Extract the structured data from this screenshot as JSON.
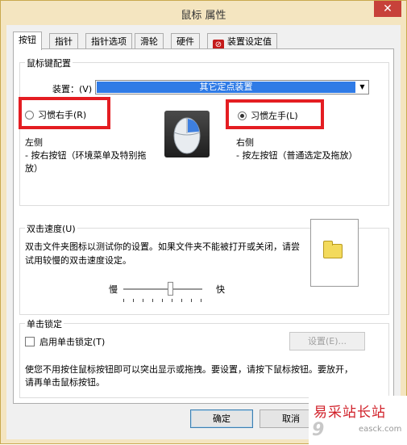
{
  "window": {
    "title": "鼠标 属性",
    "close_glyph": "✕"
  },
  "tabs": [
    {
      "label": "按钮",
      "active": true
    },
    {
      "label": "指针"
    },
    {
      "label": "指针选项"
    },
    {
      "label": "滑轮"
    },
    {
      "label": "硬件"
    },
    {
      "label": "装置设定值",
      "icon": "synaptics-icon"
    }
  ],
  "buttons_config": {
    "group_title": "鼠标键配置",
    "device_label": "装置：(V)",
    "device_value": "其它定点装置",
    "right_hand": {
      "label": "习惯右手(R)",
      "checked": false
    },
    "left_hand": {
      "label": "习惯左手(L)",
      "checked": true
    },
    "left_title": "左侧",
    "left_desc": [
      "- 按右按钮（环境菜单及特别拖",
      "放）"
    ],
    "right_title": "右侧",
    "right_desc": [
      "- 按左按钮（普通选定及拖放）"
    ],
    "highlight_color": "#e41d22"
  },
  "double_click": {
    "group_title": "双击速度(U)",
    "desc": [
      "双击文件夹图标以测试你的设置。如果文件夹不能被打开或关闭，请尝",
      "试用较慢的双击速度设定。"
    ],
    "slow_label": "慢",
    "fast_label": "快",
    "speed_fraction": 0.6
  },
  "click_lock": {
    "group_title": "单击锁定",
    "checkbox_label": "启用单击锁定(T)",
    "checked": false,
    "settings_button": "设置(E)...",
    "desc": [
      "使您不用按住鼠标按钮即可以突出显示或拖拽。要设置，请按下鼠标按钮。要放开，",
      "请再单击鼠标按钮。"
    ]
  },
  "footer": {
    "ok": "确定",
    "cancel": "取消"
  },
  "watermark": {
    "main": "易采站长站",
    "sub": "easck.com"
  }
}
